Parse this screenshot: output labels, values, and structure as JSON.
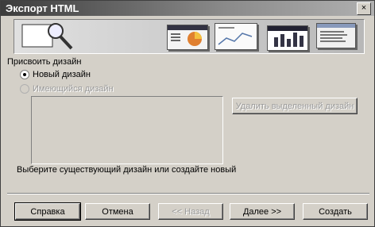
{
  "window": {
    "title": "Экспорт HTML",
    "close_glyph": "×"
  },
  "banner": {
    "icon": "magnifier-on-page-icon",
    "thumbnails": [
      "pie-chart-slide",
      "chart-slide",
      "bar-chart-slide",
      "text-slide"
    ]
  },
  "design": {
    "section_title": "Присвоить дизайн",
    "options": [
      {
        "label": "Новый дизайн",
        "checked": true,
        "enabled": true
      },
      {
        "label": "Имеющийся дизайн",
        "checked": false,
        "enabled": false
      }
    ],
    "delete_button": "Удалить выделенный дизайн",
    "hint": "Выберите существующий дизайн или создайте новый"
  },
  "footer": {
    "help": "Справка",
    "cancel": "Отмена",
    "back": "<< Назад",
    "next": "Далее >>",
    "create": "Создать"
  }
}
